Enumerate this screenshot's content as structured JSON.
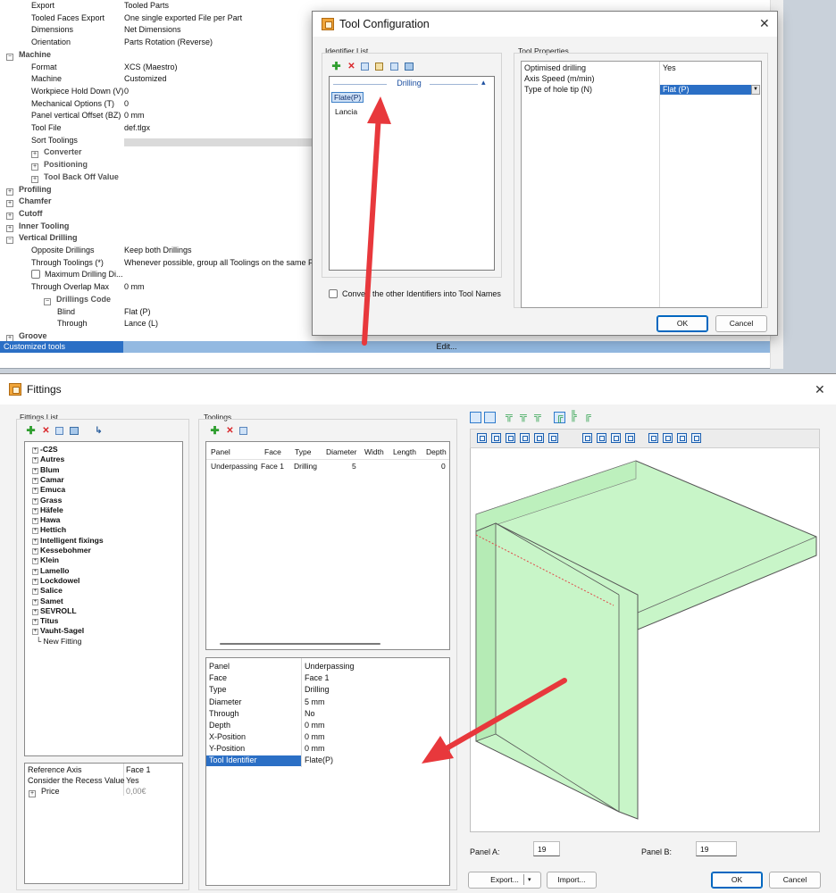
{
  "props": {
    "rows": [
      {
        "k": "Export",
        "v": "Tooled Parts",
        "kind": "item"
      },
      {
        "k": "Tooled Faces Export",
        "v": "One single exported File per Part",
        "kind": "item"
      },
      {
        "k": "Dimensions",
        "v": "Net Dimensions",
        "kind": "item"
      },
      {
        "k": "Orientation",
        "v": "Parts Rotation (Reverse)",
        "kind": "item"
      },
      {
        "k": "Machine",
        "v": "",
        "kind": "group",
        "exp": "⊟"
      },
      {
        "k": "Format",
        "v": "XCS (Maestro)",
        "kind": "item"
      },
      {
        "k": "Machine",
        "v": "Customized",
        "kind": "item"
      },
      {
        "k": "Workpiece Hold Down (V)",
        "v": "0",
        "kind": "item"
      },
      {
        "k": "Mechanical Options (T)",
        "v": "0",
        "kind": "item"
      },
      {
        "k": "Panel vertical Offset (BZ)",
        "v": "0 mm",
        "kind": "item"
      },
      {
        "k": "Tool File",
        "v": "def.tlgx",
        "kind": "item"
      },
      {
        "k": "Sort Toolings",
        "v": "",
        "kind": "item"
      },
      {
        "k": "Converter",
        "v": "",
        "kind": "sub",
        "exp": "⊞"
      },
      {
        "k": "Positioning",
        "v": "",
        "kind": "sub",
        "exp": "⊞"
      },
      {
        "k": "Tool Back Off Value",
        "v": "",
        "kind": "sub",
        "exp": "⊞"
      },
      {
        "k": "Profiling",
        "v": "",
        "kind": "group",
        "exp": "⊞"
      },
      {
        "k": "Chamfer",
        "v": "",
        "kind": "group",
        "exp": "⊞"
      },
      {
        "k": "Cutoff",
        "v": "",
        "kind": "group",
        "exp": "⊞"
      },
      {
        "k": "Inner Tooling",
        "v": "",
        "kind": "group",
        "exp": "⊞"
      },
      {
        "k": "Vertical Drilling",
        "v": "",
        "kind": "group",
        "exp": "⊟"
      },
      {
        "k": "Opposite Drillings",
        "v": "Keep both Drillings",
        "kind": "item"
      },
      {
        "k": "Through Toolings (*)",
        "v": "Whenever possible, group all Toolings on the same Fac",
        "kind": "item"
      },
      {
        "k": "Maximum Drilling Di...",
        "v": "",
        "kind": "check"
      },
      {
        "k": "Through Overlap Max",
        "v": "0 mm",
        "kind": "item"
      },
      {
        "k": "Drillings Code",
        "v": "",
        "kind": "sub",
        "exp": "⊟"
      },
      {
        "k": "Blind",
        "v": "Flat (P)",
        "kind": "deep"
      },
      {
        "k": "Through",
        "v": "Lance (L)",
        "kind": "deep"
      },
      {
        "k": "Groove",
        "v": "",
        "kind": "group",
        "exp": "⊞"
      }
    ],
    "selected_row": {
      "k": "Customized tools",
      "v": "Edit..."
    }
  },
  "tool_config": {
    "title": "Tool Configuration",
    "close": "✕",
    "identifier_list_label": "Identifier List",
    "list_header": "Drilling",
    "list_header_chevron": "▴",
    "items": [
      "Flate(P)",
      "Lancia"
    ],
    "convert_label": "Convert the other Identifiers into Tool Names",
    "tool_properties_label": "Tool Properties",
    "properties": [
      {
        "k": "Optimised drilling",
        "v": "Yes"
      },
      {
        "k": "Axis Speed (m/min)",
        "v": ""
      },
      {
        "k": "Type of hole tip (N)",
        "v": "Flat (P)"
      }
    ],
    "ok": "OK",
    "cancel": "Cancel"
  },
  "fittings": {
    "title": "Fittings",
    "close": "✕",
    "list_label": "Fittings List",
    "tree": [
      "-C2S",
      "Autres",
      "Blum",
      "Camar",
      "Emuca",
      "Grass",
      "Häfele",
      "Hawa",
      "Hettich",
      "Intelligent fixings",
      "Kessebohmer",
      "Klein",
      "Lamello",
      "Lockdowel",
      "Salice",
      "Samet",
      "SEVROLL",
      "Titus",
      "Vauht-Sagel"
    ],
    "new_fitting": "New Fitting",
    "fitting_props": [
      {
        "k": "Reference Axis",
        "v": "Face 1"
      },
      {
        "k": "Consider the Recess Value",
        "v": "Yes"
      },
      {
        "k": "Price",
        "v": "0,00€"
      }
    ],
    "toolings_label": "Toolings",
    "toolings_headers": [
      "Panel",
      "Face",
      "Type",
      "Diameter",
      "Width",
      "Length",
      "Depth"
    ],
    "toolings_row": [
      "Underpassing",
      "Face 1",
      "Drilling",
      "5",
      "",
      "",
      "0"
    ],
    "tooling_props": [
      {
        "k": "Panel",
        "v": "Underpassing"
      },
      {
        "k": "Face",
        "v": "Face 1"
      },
      {
        "k": "Type",
        "v": "Drilling"
      },
      {
        "k": "Diameter",
        "v": "5 mm"
      },
      {
        "k": "Through",
        "v": "No"
      },
      {
        "k": "Depth",
        "v": "0 mm"
      },
      {
        "k": "X-Position",
        "v": "0 mm"
      },
      {
        "k": "Y-Position",
        "v": "0 mm"
      }
    ],
    "tool_identifier": {
      "k": "Tool Identifier",
      "v": "Flate(P)"
    },
    "panel_a_label": "Panel A:",
    "panel_a_value": "19",
    "panel_b_label": "Panel B:",
    "panel_b_value": "19",
    "export": "Export...",
    "import": "Import...",
    "ok": "OK",
    "cancel": "Cancel"
  },
  "colors": {
    "selection": "#2b6fc5",
    "panel_fill": "#c8f5c8",
    "arrow": "#e8383c"
  }
}
